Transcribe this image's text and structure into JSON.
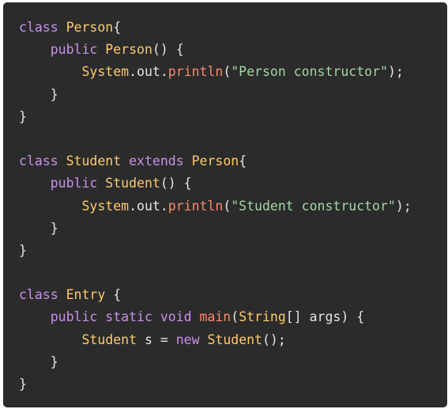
{
  "code": {
    "line_1": {
      "kw": "class",
      "type": "Person",
      "rest": "{"
    },
    "line_2": {
      "indent": "    ",
      "kw": "public",
      "type": "Person",
      "rest": "() {"
    },
    "line_3": {
      "indent": "        ",
      "obj": "System",
      "mid": ".out.",
      "fn": "println",
      "open": "(",
      "str": "\"Person constructor\"",
      "close": ");"
    },
    "line_4": {
      "indent": "    ",
      "rest": "}"
    },
    "line_5": {
      "rest": "}"
    },
    "line_7": {
      "kw": "class",
      "type": "Student",
      "kw2": "extends",
      "type2": "Person",
      "rest": "{"
    },
    "line_8": {
      "indent": "    ",
      "kw": "public",
      "type": "Student",
      "rest": "() {"
    },
    "line_9": {
      "indent": "        ",
      "obj": "System",
      "mid": ".out.",
      "fn": "println",
      "open": "(",
      "str": "\"Student constructor\"",
      "close": ");"
    },
    "line_10": {
      "indent": "    ",
      "rest": "}"
    },
    "line_11": {
      "rest": "}"
    },
    "line_13": {
      "kw": "class",
      "type": "Entry",
      "rest": " {"
    },
    "line_14": {
      "indent": "    ",
      "kw": "public static void",
      "fn": "main",
      "open": "(",
      "type": "String",
      "args": "[] args) {"
    },
    "line_15": {
      "indent": "        ",
      "type": "Student",
      "mid": " s = ",
      "kw": "new",
      "type2": "Student",
      "close": "();"
    },
    "line_16": {
      "indent": "    ",
      "rest": "}"
    },
    "line_17": {
      "rest": "}"
    }
  },
  "colors": {
    "background": "#2b2b2b",
    "keyword": "#c792ea",
    "type": "#ffcb6b",
    "function": "#f78c6c",
    "string": "#a5d6a7",
    "plain": "#e6e6e6"
  }
}
